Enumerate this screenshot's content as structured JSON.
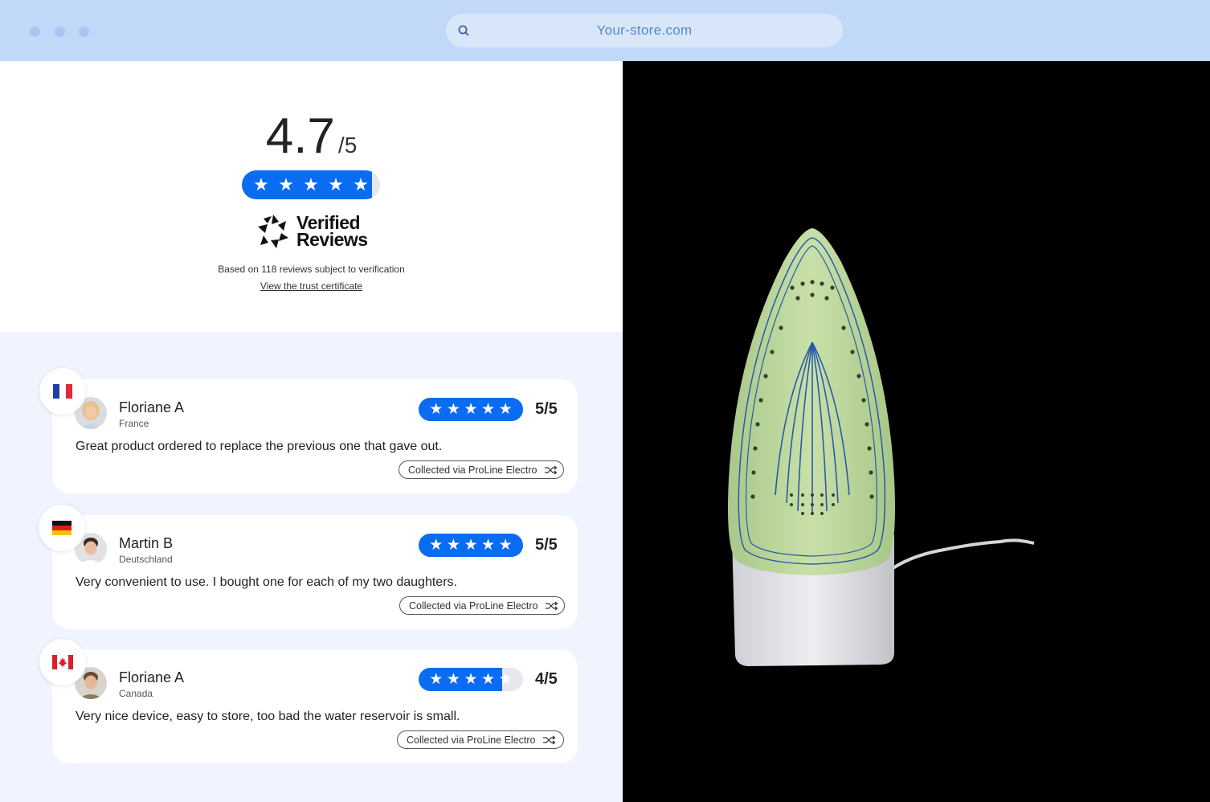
{
  "browser": {
    "url": "Your-store.com"
  },
  "summary": {
    "score": "4.7",
    "score_max": "/5",
    "rating_fraction": 0.94,
    "brand_line1": "Verified",
    "brand_line2": "Reviews",
    "based_on": "Based on 118 reviews subject to verification",
    "certificate_link": "View the trust certificate"
  },
  "reviews": [
    {
      "name": "Floriane A",
      "country": "France",
      "flag": "france-flag",
      "rating": 5,
      "score_text": "5/5",
      "text": "Great product ordered to replace the previous one that gave out.",
      "collected": "Collected via ProLine Electro"
    },
    {
      "name": "Martin B",
      "country": "Deutschland",
      "flag": "germany-flag",
      "rating": 5,
      "score_text": "5/5",
      "text": "Very convenient to use. I bought one for each of my two daughters.",
      "collected": "Collected via ProLine Electro"
    },
    {
      "name": "Floriane A",
      "country": "Canada",
      "flag": "canada-flag",
      "rating": 4,
      "score_text": "4/5",
      "text": "Very nice device, easy to store, too bad the water reservoir is small.",
      "collected": "Collected via ProLine Electro"
    }
  ],
  "colors": {
    "accent_blue": "#0a6cf0",
    "chrome_bg": "#c2d8f8",
    "reviews_bg": "#eff4fe"
  },
  "icons": {
    "search": "search-icon",
    "star": "star-icon",
    "collected": "shuffle-icon",
    "product": "steam-iron-image"
  }
}
